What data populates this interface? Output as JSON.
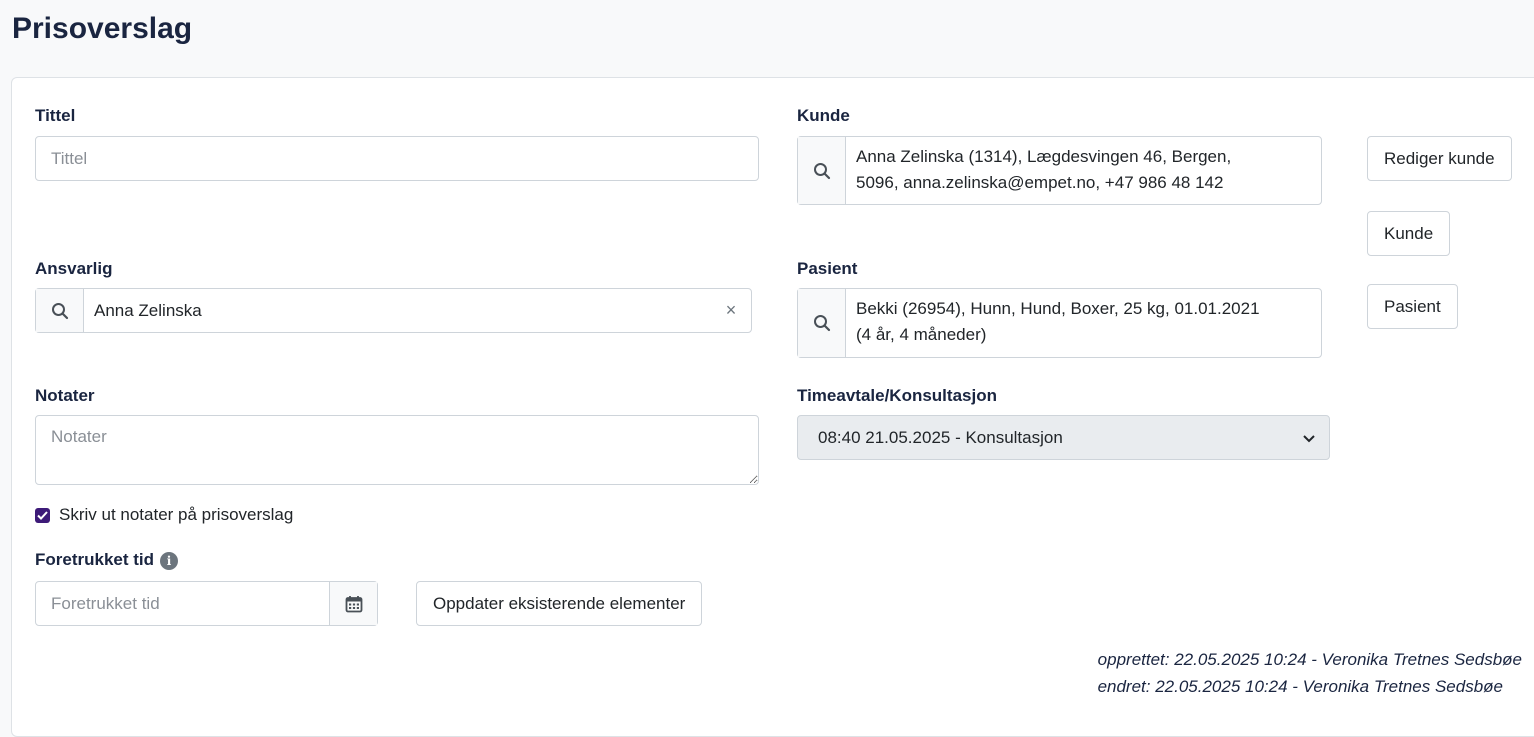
{
  "page": {
    "title": "Prisoverslag"
  },
  "form": {
    "tittel": {
      "label": "Tittel",
      "placeholder": "Tittel",
      "value": ""
    },
    "kunde": {
      "label": "Kunde",
      "line1": "Anna Zelinska (1314), Lægdesvingen 46, Bergen,",
      "line2": "5096, anna.zelinska@empet.no, +47 986 48 142",
      "edit_button": "Rediger kunde",
      "customer_button": "Kunde"
    },
    "ansvarlig": {
      "label": "Ansvarlig",
      "value": "Anna Zelinska",
      "clear": "×"
    },
    "pasient": {
      "label": "Pasient",
      "line1": "Bekki (26954), Hunn, Hund, Boxer, 25 kg, 01.01.2021",
      "line2": "(4 år, 4 måneder)",
      "patient_button": "Pasient"
    },
    "notater": {
      "label": "Notater",
      "placeholder": "Notater",
      "value": ""
    },
    "timeavtale": {
      "label": "Timeavtale/Konsultasjon",
      "selected": "08:40 21.05.2025 - Konsultasjon"
    },
    "print_notes": {
      "label": "Skriv ut notater på prisoverslag",
      "checked": true
    },
    "foretrukket_tid": {
      "label": "Foretrukket tid",
      "placeholder": "Foretrukket tid"
    },
    "update_button": "Oppdater eksisterende elementer"
  },
  "meta": {
    "created": "opprettet: 22.05.2025 10:24 - Veronika Tretnes Sedsbøe",
    "modified": "endret: 22.05.2025 10:24 - Veronika Tretnes Sedsbøe"
  },
  "colors": {
    "title": "#1a2540",
    "checkbox": "#3d1a78",
    "select_bg": "#e9ecef"
  }
}
